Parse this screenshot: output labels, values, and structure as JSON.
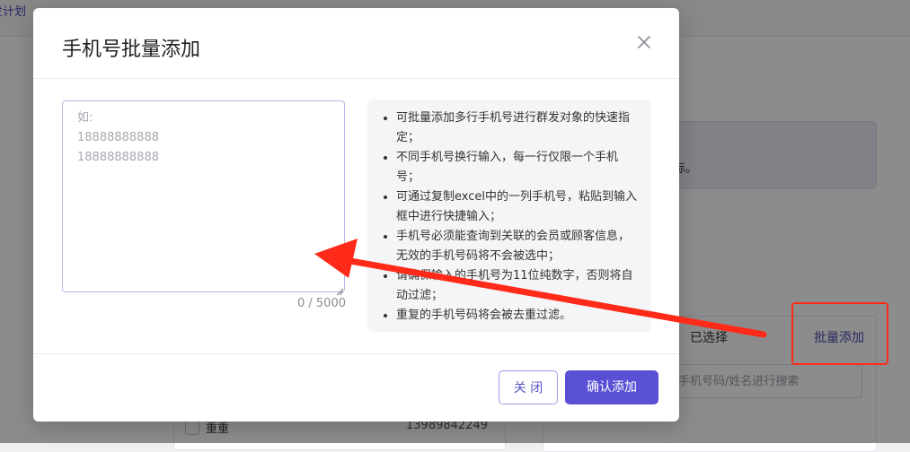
{
  "background": {
    "page_title_fragment": "发计划",
    "notice_fragment": "际。",
    "tab_selected": "已选择",
    "batch_add_link": "批量添加",
    "search_placeholder": "手机号码/姓名进行搜索",
    "row": {
      "name": "重重",
      "phone": "13989842249"
    }
  },
  "modal": {
    "title": "手机号批量添加",
    "input": {
      "placeholder": "如:\n18888888888\n18888888888",
      "value": "",
      "counter": "0 / 5000"
    },
    "tips": [
      "可批量添加多行手机号进行群发对象的快速指定；",
      "不同手机号换行输入，每一行仅限一个手机号；",
      "可通过复制excel中的一列手机号，粘贴到输入框中进行快捷输入；",
      "手机号必须能查询到关联的会员或顾客信息，无效的手机号码将不会被选中；",
      "请确保输入的手机号为11位纯数字，否则将自动过滤；",
      "重复的手机号码将会被去重过滤。"
    ],
    "buttons": {
      "close": "关 闭",
      "confirm": "确认添加"
    }
  },
  "colors": {
    "accent": "#5a50d6",
    "annotation": "#ff2a1a"
  },
  "icons": {
    "close": "close-icon"
  }
}
